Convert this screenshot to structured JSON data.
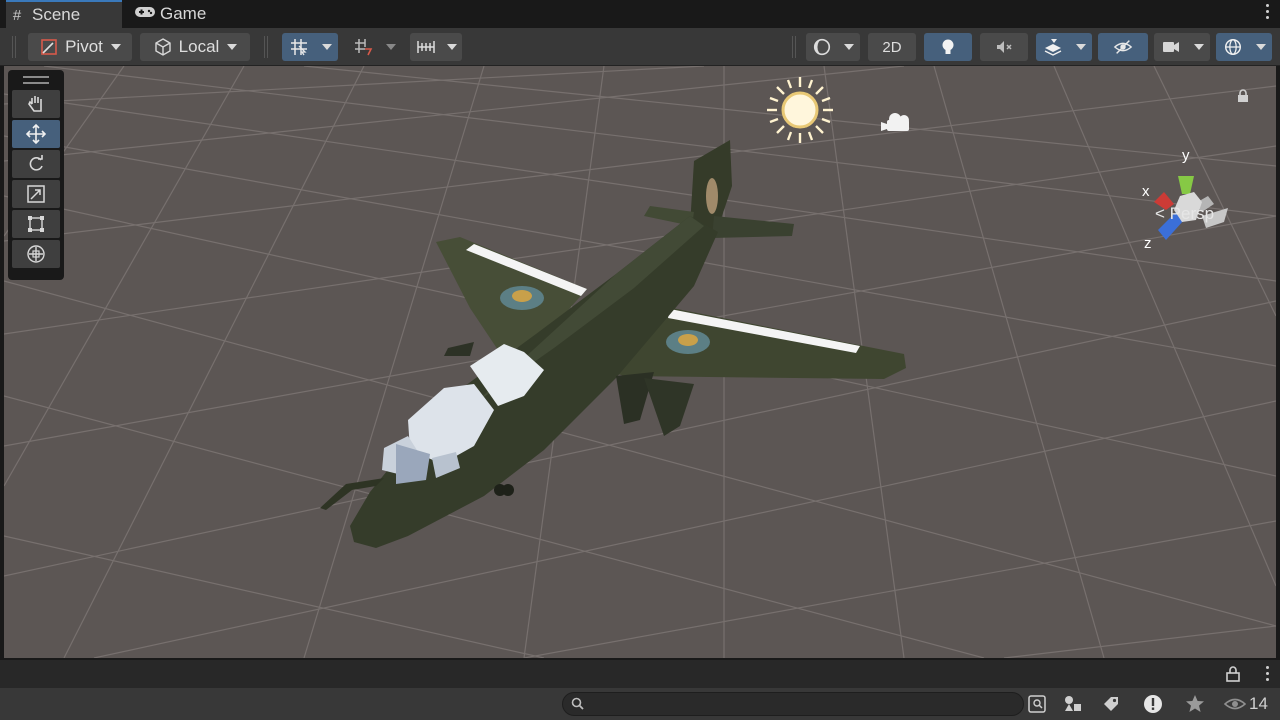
{
  "tabs": [
    {
      "label": "Scene",
      "icon": "grid-hash-icon",
      "active": true
    },
    {
      "label": "Game",
      "icon": "gamepad-icon",
      "active": false
    }
  ],
  "toolbar": {
    "pivot_label": "Pivot",
    "local_label": "Local",
    "twod_label": "2D"
  },
  "scene": {
    "camera_mode": "Persp",
    "axes": {
      "x": "x",
      "y": "y",
      "z": "z"
    }
  },
  "bottom": {
    "search_placeholder": "",
    "visible_count": "14"
  },
  "colors": {
    "accent": "#46607c",
    "viewport_bg": "#5c5654",
    "grid": "#7a7472",
    "aircraft": "#3d4430"
  }
}
